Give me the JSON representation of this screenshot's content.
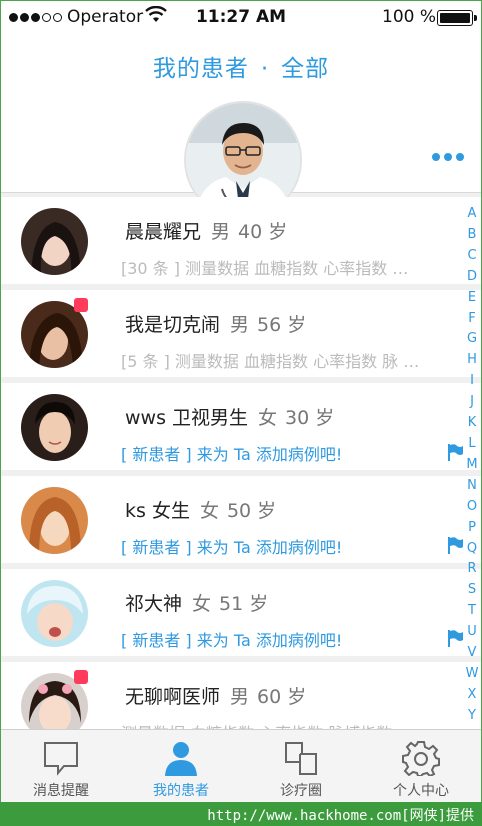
{
  "status_bar": {
    "carrier": "Operator",
    "time": "11:27 AM",
    "battery": "100 %",
    "signal_bars_filled": 3,
    "signal_bars_total": 5
  },
  "header": {
    "title_left": "我的患者",
    "separator": "·",
    "title_right": "全部",
    "more_icon": "more-dots-icon"
  },
  "patients": [
    {
      "name": "晨晨耀兄",
      "gender": "男",
      "age": "40 岁",
      "detail": "[30 条 ] 测量数据  血糖指数  心率指数 …",
      "is_new": false,
      "unread": false
    },
    {
      "name": "我是切克闹",
      "gender": "男",
      "age": "56 岁",
      "detail": "[5 条 ] 测量数据  血糖指数  心率指数 脉 …",
      "is_new": false,
      "unread": true
    },
    {
      "name": "wws 卫视男生",
      "gender": "女",
      "age": "30 岁",
      "detail": "[ 新患者 ] 来为 Ta 添加病例吧!",
      "is_new": true,
      "unread": false
    },
    {
      "name": "ks 女生",
      "gender": "女",
      "age": "50 岁",
      "detail": "[ 新患者 ] 来为 Ta 添加病例吧!",
      "is_new": true,
      "unread": false
    },
    {
      "name": "祁大神",
      "gender": "女",
      "age": "51 岁",
      "detail": "[ 新患者 ] 来为 Ta 添加病例吧!",
      "is_new": true,
      "unread": false
    },
    {
      "name": "无聊啊医师",
      "gender": "男",
      "age": "60 岁",
      "detail": "测量数据  血糖指数  心率指数 脉搏指数",
      "is_new": false,
      "unread": true
    }
  ],
  "index_letters": [
    "A",
    "B",
    "C",
    "D",
    "E",
    "F",
    "G",
    "H",
    "I",
    "J",
    "K",
    "L",
    "M",
    "N",
    "O",
    "P",
    "Q",
    "R",
    "S",
    "T",
    "U",
    "V",
    "W",
    "X",
    "Y"
  ],
  "tabs": [
    {
      "label": "消息提醒",
      "icon": "message-bubble-icon",
      "active": false
    },
    {
      "label": "我的患者",
      "icon": "person-icon",
      "active": true
    },
    {
      "label": "诊疗圈",
      "icon": "overlapping-squares-icon",
      "active": false
    },
    {
      "label": "个人中心",
      "icon": "gear-icon",
      "active": false
    }
  ],
  "footer": {
    "watermark": "http://www.hackhome.com[网侠]提供"
  },
  "colors": {
    "accent": "#2f9ae0",
    "badge": "#ff3b5c",
    "footer": "#3c9b3c"
  }
}
